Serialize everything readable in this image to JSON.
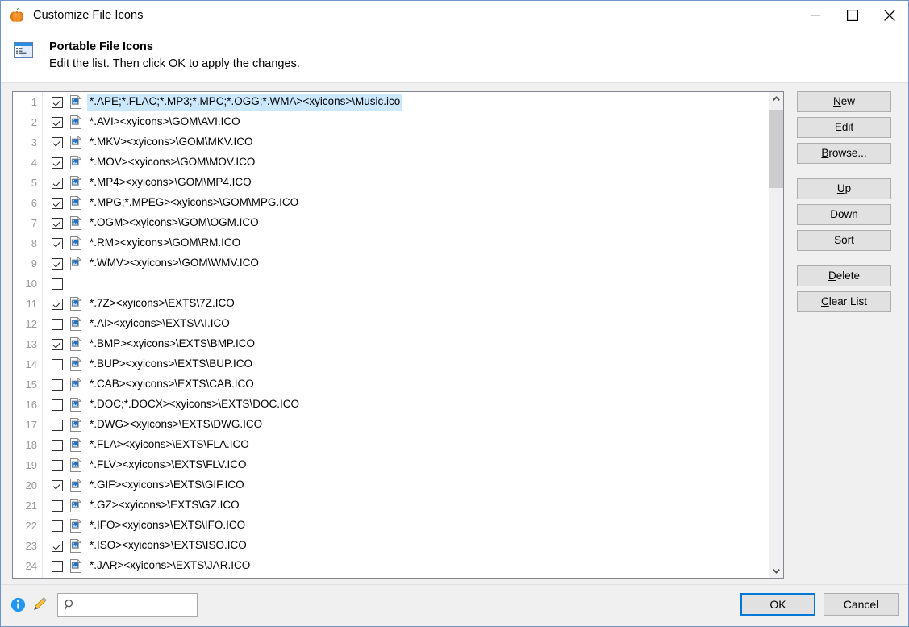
{
  "window": {
    "title": "Customize File Icons",
    "title_icon": "pumpkin-app-icon",
    "controls": {
      "minimize": "minimize-icon",
      "maximize": "maximize-icon",
      "close": "close-icon"
    }
  },
  "header": {
    "icon": "list-window-icon",
    "title": "Portable File Icons",
    "subtitle": "Edit the list. Then click OK to apply the changes."
  },
  "list": {
    "rows": [
      {
        "num": "1",
        "checked": true,
        "has_icon": true,
        "text": "*.APE;*.FLAC;*.MP3;*.MPC;*.OGG;*.WMA><xyicons>\\Music.ico",
        "selected": true
      },
      {
        "num": "2",
        "checked": true,
        "has_icon": true,
        "text": "*.AVI><xyicons>\\GOM\\AVI.ICO",
        "selected": false
      },
      {
        "num": "3",
        "checked": true,
        "has_icon": true,
        "text": "*.MKV><xyicons>\\GOM\\MKV.ICO",
        "selected": false
      },
      {
        "num": "4",
        "checked": true,
        "has_icon": true,
        "text": "*.MOV><xyicons>\\GOM\\MOV.ICO",
        "selected": false
      },
      {
        "num": "5",
        "checked": true,
        "has_icon": true,
        "text": "*.MP4><xyicons>\\GOM\\MP4.ICO",
        "selected": false
      },
      {
        "num": "6",
        "checked": true,
        "has_icon": true,
        "text": "*.MPG;*.MPEG><xyicons>\\GOM\\MPG.ICO",
        "selected": false
      },
      {
        "num": "7",
        "checked": true,
        "has_icon": true,
        "text": "*.OGM><xyicons>\\GOM\\OGM.ICO",
        "selected": false
      },
      {
        "num": "8",
        "checked": true,
        "has_icon": true,
        "text": "*.RM><xyicons>\\GOM\\RM.ICO",
        "selected": false
      },
      {
        "num": "9",
        "checked": true,
        "has_icon": true,
        "text": "*.WMV><xyicons>\\GOM\\WMV.ICO",
        "selected": false
      },
      {
        "num": "10",
        "checked": false,
        "has_icon": false,
        "text": "",
        "selected": false
      },
      {
        "num": "11",
        "checked": true,
        "has_icon": true,
        "text": "*.7Z><xyicons>\\EXTS\\7Z.ICO",
        "selected": false
      },
      {
        "num": "12",
        "checked": false,
        "has_icon": true,
        "text": "*.AI><xyicons>\\EXTS\\AI.ICO",
        "selected": false
      },
      {
        "num": "13",
        "checked": true,
        "has_icon": true,
        "text": "*.BMP><xyicons>\\EXTS\\BMP.ICO",
        "selected": false
      },
      {
        "num": "14",
        "checked": false,
        "has_icon": true,
        "text": "*.BUP><xyicons>\\EXTS\\BUP.ICO",
        "selected": false
      },
      {
        "num": "15",
        "checked": false,
        "has_icon": true,
        "text": "*.CAB><xyicons>\\EXTS\\CAB.ICO",
        "selected": false
      },
      {
        "num": "16",
        "checked": false,
        "has_icon": true,
        "text": "*.DOC;*.DOCX><xyicons>\\EXTS\\DOC.ICO",
        "selected": false
      },
      {
        "num": "17",
        "checked": false,
        "has_icon": true,
        "text": "*.DWG><xyicons>\\EXTS\\DWG.ICO",
        "selected": false
      },
      {
        "num": "18",
        "checked": false,
        "has_icon": true,
        "text": "*.FLA><xyicons>\\EXTS\\FLA.ICO",
        "selected": false
      },
      {
        "num": "19",
        "checked": false,
        "has_icon": true,
        "text": "*.FLV><xyicons>\\EXTS\\FLV.ICO",
        "selected": false
      },
      {
        "num": "20",
        "checked": true,
        "has_icon": true,
        "text": "*.GIF><xyicons>\\EXTS\\GIF.ICO",
        "selected": false
      },
      {
        "num": "21",
        "checked": false,
        "has_icon": true,
        "text": "*.GZ><xyicons>\\EXTS\\GZ.ICO",
        "selected": false
      },
      {
        "num": "22",
        "checked": false,
        "has_icon": true,
        "text": "*.IFO><xyicons>\\EXTS\\IFO.ICO",
        "selected": false
      },
      {
        "num": "23",
        "checked": true,
        "has_icon": true,
        "text": "*.ISO><xyicons>\\EXTS\\ISO.ICO",
        "selected": false
      },
      {
        "num": "24",
        "checked": false,
        "has_icon": true,
        "text": "*.JAR><xyicons>\\EXTS\\JAR.ICO",
        "selected": false
      }
    ],
    "scrollbar": {
      "up_icon": "chevron-up-icon",
      "down_icon": "chevron-down-icon"
    }
  },
  "side_buttons": {
    "groups": [
      [
        {
          "id": "new",
          "pre": "",
          "accel": "N",
          "post": "ew"
        },
        {
          "id": "edit",
          "pre": "",
          "accel": "E",
          "post": "dit"
        },
        {
          "id": "browse",
          "pre": "",
          "accel": "B",
          "post": "rowse..."
        }
      ],
      [
        {
          "id": "up",
          "pre": "",
          "accel": "U",
          "post": "p"
        },
        {
          "id": "down",
          "pre": "Do",
          "accel": "w",
          "post": "n"
        },
        {
          "id": "sort",
          "pre": "",
          "accel": "S",
          "post": "ort"
        }
      ],
      [
        {
          "id": "delete",
          "pre": "",
          "accel": "D",
          "post": "elete"
        },
        {
          "id": "clear-list",
          "pre": "",
          "accel": "C",
          "post": "lear List"
        }
      ]
    ]
  },
  "footer": {
    "info_icon": "info-icon",
    "pencil_icon": "pencil-edit-icon",
    "search": {
      "icon": "search-icon",
      "value": "",
      "placeholder": ""
    },
    "ok_label": "OK",
    "cancel_label": "Cancel"
  },
  "colors": {
    "window_border": "#6f94c8",
    "selection": "#cce8ff",
    "accent": "#0078d7",
    "dialog_bg": "#f0f0f0",
    "button_bg": "#e1e1e1",
    "row_number": "#9a9a9a"
  }
}
